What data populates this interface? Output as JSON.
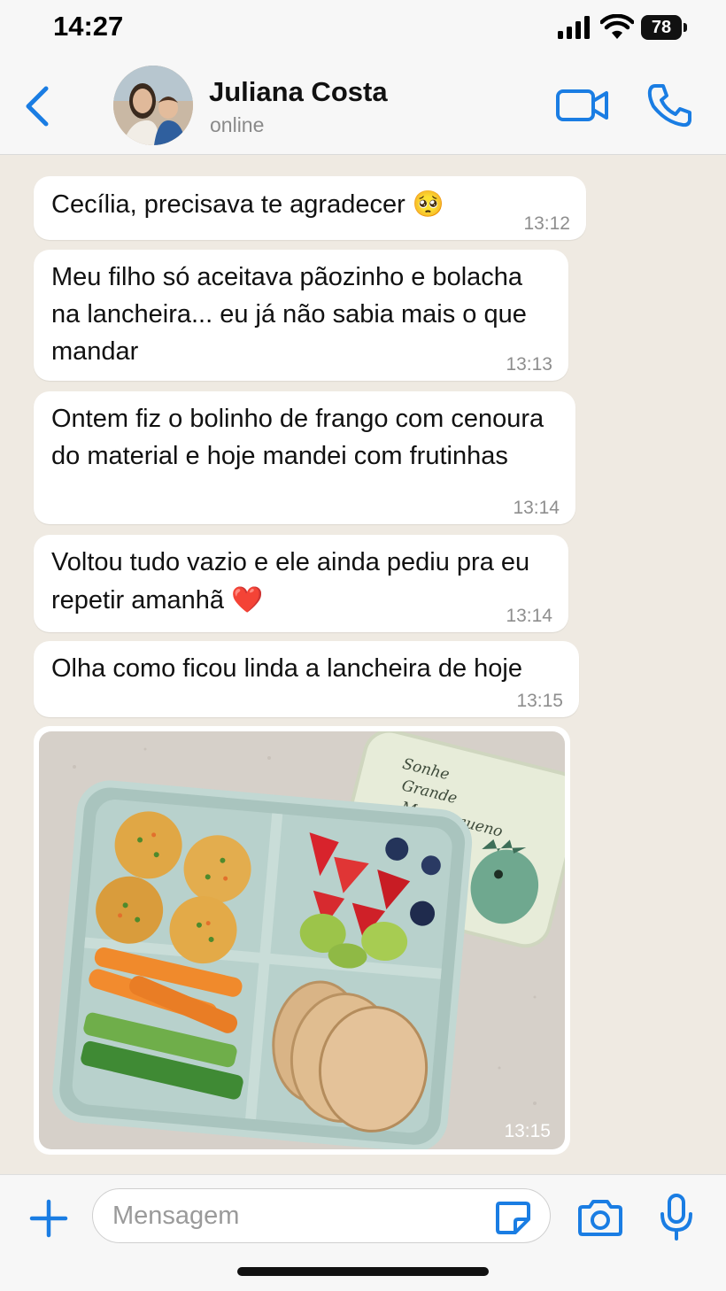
{
  "status_bar": {
    "time": "14:27",
    "battery": "78"
  },
  "header": {
    "contact_name": "Juliana Costa",
    "contact_status": "online",
    "icons": [
      "chevron-left-icon",
      "video-call-icon",
      "phone-icon"
    ]
  },
  "messages": [
    {
      "text": "Cecília, precisava te agradecer",
      "emoji": "🥺",
      "time": "13:12"
    },
    {
      "text": "Meu filho só aceitava pãozinho e bolacha na lancheira... eu já não sabia mais o que mandar",
      "time": "13:13"
    },
    {
      "text": "Ontem fiz o bolinho de frango com cenoura do material e hoje mandei com frutinhas",
      "time": "13:14"
    },
    {
      "text": "Voltou tudo vazio e ele ainda pediu pra eu repetir amanhã",
      "emoji": "❤️",
      "time": "13:14"
    },
    {
      "text": "Olha como ficou linda a lancheira de hoje",
      "time": "13:15"
    }
  ],
  "photo": {
    "time": "13:15",
    "lid_text": "Sonhe Grande Meu Pequeno"
  },
  "input": {
    "placeholder": "Mensagem",
    "icons": [
      "plus-icon",
      "sticker-icon",
      "camera-icon",
      "microphone-icon"
    ]
  },
  "colors": {
    "accent": "#1a7de3",
    "chat_bg": "#efeae2",
    "bubble": "#ffffff"
  }
}
